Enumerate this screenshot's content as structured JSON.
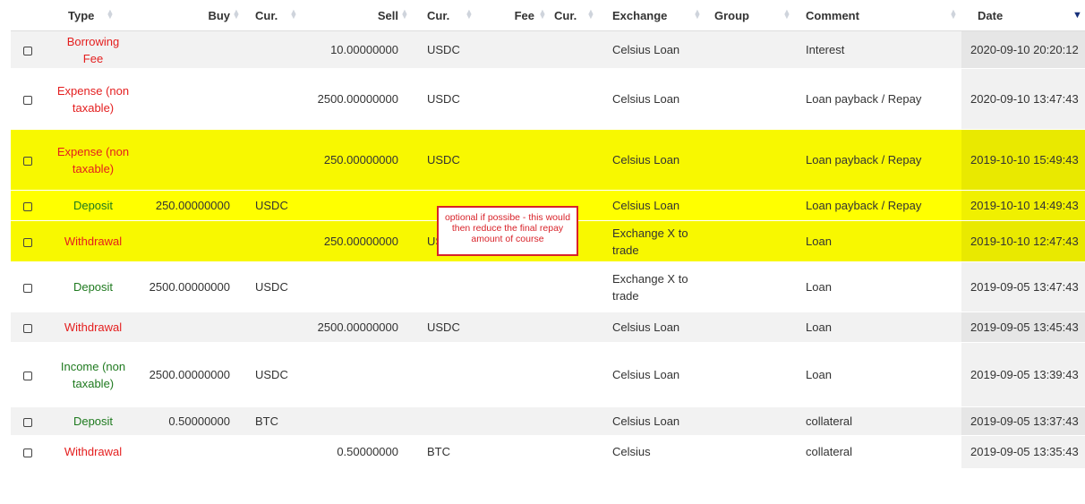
{
  "columns": [
    {
      "key": "check",
      "label": ""
    },
    {
      "key": "type",
      "label": "Type"
    },
    {
      "key": "buy",
      "label": "Buy"
    },
    {
      "key": "buy_cur",
      "label": "Cur."
    },
    {
      "key": "sell",
      "label": "Sell"
    },
    {
      "key": "sell_cur",
      "label": "Cur."
    },
    {
      "key": "fee",
      "label": "Fee"
    },
    {
      "key": "fee_cur",
      "label": "Cur."
    },
    {
      "key": "exchange",
      "label": "Exchange"
    },
    {
      "key": "group",
      "label": "Group"
    },
    {
      "key": "comment",
      "label": "Comment"
    },
    {
      "key": "date",
      "label": "Date"
    }
  ],
  "rows": [
    {
      "type": "Borrowing Fee",
      "type_color": "#e41e1e",
      "buy": "",
      "buy_cur": "",
      "sell": "10.00000000",
      "sell_cur": "USDC",
      "fee": "",
      "fee_cur": "",
      "exchange": "Celsius Loan",
      "group": "",
      "comment": "Interest",
      "date": "2020-09-10 20:20:12",
      "highlight": false
    },
    {
      "type": "Expense (non taxable)",
      "type_color": "#e41e1e",
      "buy": "",
      "buy_cur": "",
      "sell": "2500.00000000",
      "sell_cur": "USDC",
      "fee": "",
      "fee_cur": "",
      "exchange": "Celsius Loan",
      "group": "",
      "comment": "Loan payback / Repay",
      "date": "2020-09-10 13:47:43",
      "highlight": false
    },
    {
      "type": "Expense (non taxable)",
      "type_color": "#e41e1e",
      "buy": "",
      "buy_cur": "",
      "sell": "250.00000000",
      "sell_cur": "USDC",
      "fee": "",
      "fee_cur": "",
      "exchange": "Celsius Loan",
      "group": "",
      "comment": "Loan payback / Repay",
      "date": "2019-10-10 15:49:43",
      "highlight": true
    },
    {
      "type": "Deposit",
      "type_color": "#1f7a1f",
      "buy": "250.00000000",
      "buy_cur": "USDC",
      "sell": "",
      "sell_cur": "",
      "fee": "",
      "fee_cur": "",
      "exchange": "Celsius Loan",
      "group": "",
      "comment": "Loan payback / Repay",
      "date": "2019-10-10 14:49:43",
      "highlight": true
    },
    {
      "type": "Withdrawal",
      "type_color": "#e41e1e",
      "buy": "",
      "buy_cur": "",
      "sell": "250.00000000",
      "sell_cur": "USDC",
      "fee": "",
      "fee_cur": "",
      "exchange": "Exchange X to trade",
      "group": "",
      "comment": "Loan",
      "date": "2019-10-10 12:47:43",
      "highlight": true
    },
    {
      "type": "Deposit",
      "type_color": "#1f7a1f",
      "buy": "2500.00000000",
      "buy_cur": "USDC",
      "sell": "",
      "sell_cur": "",
      "fee": "",
      "fee_cur": "",
      "exchange": "Exchange X to trade",
      "group": "",
      "comment": "Loan",
      "date": "2019-09-05 13:47:43",
      "highlight": false
    },
    {
      "type": "Withdrawal",
      "type_color": "#e41e1e",
      "buy": "",
      "buy_cur": "",
      "sell": "2500.00000000",
      "sell_cur": "USDC",
      "fee": "",
      "fee_cur": "",
      "exchange": "Celsius Loan",
      "group": "",
      "comment": "Loan",
      "date": "2019-09-05 13:45:43",
      "highlight": false
    },
    {
      "type": "Income (non taxable)",
      "type_color": "#1f7a1f",
      "buy": "2500.00000000",
      "buy_cur": "USDC",
      "sell": "",
      "sell_cur": "",
      "fee": "",
      "fee_cur": "",
      "exchange": "Celsius Loan",
      "group": "",
      "comment": "Loan",
      "date": "2019-09-05 13:39:43",
      "highlight": false
    },
    {
      "type": "Deposit",
      "type_color": "#1f7a1f",
      "buy": "0.50000000",
      "buy_cur": "BTC",
      "sell": "",
      "sell_cur": "",
      "fee": "",
      "fee_cur": "",
      "exchange": "Celsius Loan",
      "group": "",
      "comment": "collateral",
      "date": "2019-09-05 13:37:43",
      "highlight": false
    },
    {
      "type": "Withdrawal",
      "type_color": "#e41e1e",
      "buy": "",
      "buy_cur": "",
      "sell": "0.50000000",
      "sell_cur": "BTC",
      "fee": "",
      "fee_cur": "",
      "exchange": "Celsius",
      "group": "",
      "comment": "collateral",
      "date": "2019-09-05 13:35:43",
      "highlight": false
    }
  ],
  "annotation": {
    "text": "optional if possibe - this would then reduce the final repay amount of course",
    "color": "#d8232a"
  },
  "colors": {
    "highlight": "#ffff00",
    "sort_active": "#17307a"
  }
}
